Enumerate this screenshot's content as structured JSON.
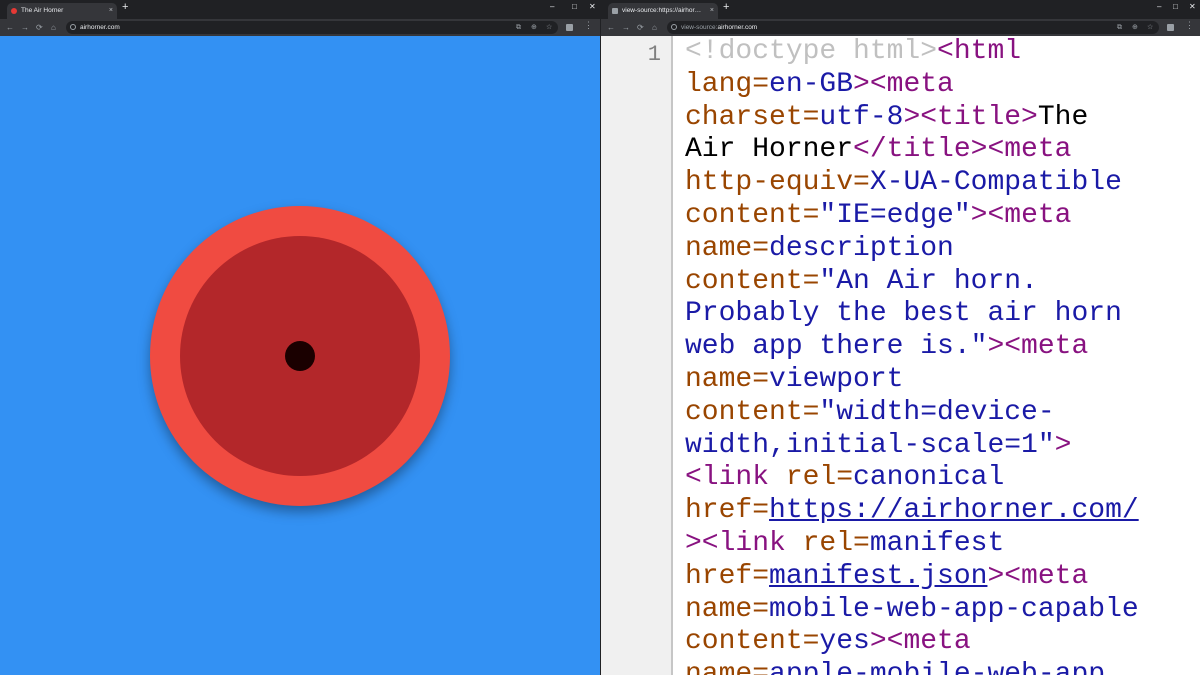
{
  "left_window": {
    "tab": {
      "title": "The Air Horner",
      "favicon_color": "#e53935",
      "close_label": "×"
    },
    "new_tab_label": "+",
    "window_controls": {
      "minimize": "–",
      "maximize": "□",
      "close": "✕"
    },
    "nav": {
      "back": "←",
      "forward": "→",
      "reload": "⟳",
      "home": "⌂"
    },
    "omnibox": {
      "url": "airhorner.com"
    },
    "omnibox_icons": {
      "install": "⧉",
      "zoom": "⊕",
      "bookmark": "☆"
    },
    "menu": "⋮"
  },
  "right_window": {
    "tab": {
      "title": "view-source:https://airhorner.com",
      "favicon_color": "#9aa0a6",
      "close_label": "×"
    },
    "new_tab_label": "+",
    "window_controls": {
      "minimize": "–",
      "maximize": "□",
      "close": "✕"
    },
    "nav": {
      "back": "←",
      "forward": "→",
      "reload": "⟳",
      "home": "⌂"
    },
    "omnibox": {
      "url_prefix": "view-source:",
      "url_main": "airhorner.com"
    },
    "omnibox_icons": {
      "install": "⧉",
      "zoom": "⊕",
      "bookmark": "☆"
    },
    "menu": "⋮"
  },
  "airhorn": {
    "background": "#3391f3",
    "outer_color": "#f04b41",
    "inner_color": "#b3272a",
    "center_color": "#1a0000"
  },
  "source": {
    "line_number": "1",
    "colors": {
      "tag": "#881280",
      "attr": "#994500",
      "value": "#1a1aa6",
      "text": "#000000",
      "doctype": "#c0c0c0"
    },
    "lines": [
      [
        {
          "t": "doc",
          "v": "<!doctype html>"
        },
        {
          "t": "tag",
          "v": "<html"
        }
      ],
      [
        {
          "t": "attr",
          "v": "lang="
        },
        {
          "t": "val",
          "v": "en-GB"
        },
        {
          "t": "tag",
          "v": "><meta"
        }
      ],
      [
        {
          "t": "attr",
          "v": "charset="
        },
        {
          "t": "val",
          "v": "utf-8"
        },
        {
          "t": "tag",
          "v": "><title>"
        },
        {
          "t": "txt",
          "v": "The"
        }
      ],
      [
        {
          "t": "txt",
          "v": "Air Horner"
        },
        {
          "t": "tag",
          "v": "</title><meta"
        }
      ],
      [
        {
          "t": "attr",
          "v": "http-equiv="
        },
        {
          "t": "val",
          "v": "X-UA-Compatible"
        }
      ],
      [
        {
          "t": "attr",
          "v": "content="
        },
        {
          "t": "val",
          "v": "\"IE=edge\""
        },
        {
          "t": "tag",
          "v": "><meta"
        }
      ],
      [
        {
          "t": "attr",
          "v": "name="
        },
        {
          "t": "val",
          "v": "description"
        }
      ],
      [
        {
          "t": "attr",
          "v": "content="
        },
        {
          "t": "val",
          "v": "\"An Air horn."
        }
      ],
      [
        {
          "t": "val",
          "v": "Probably the best air horn"
        }
      ],
      [
        {
          "t": "val",
          "v": "web app there is.\""
        },
        {
          "t": "tag",
          "v": "><meta"
        }
      ],
      [
        {
          "t": "attr",
          "v": "name="
        },
        {
          "t": "val",
          "v": "viewport"
        }
      ],
      [
        {
          "t": "attr",
          "v": "content="
        },
        {
          "t": "val",
          "v": "\"width=device-"
        }
      ],
      [
        {
          "t": "val",
          "v": "width,initial-scale=1\""
        },
        {
          "t": "tag",
          "v": ">"
        }
      ],
      [
        {
          "t": "tag",
          "v": "<link"
        },
        {
          "t": "attr",
          "v": " rel="
        },
        {
          "t": "val",
          "v": "canonical"
        }
      ],
      [
        {
          "t": "attr",
          "v": "href="
        },
        {
          "t": "link",
          "v": "https://airhorner.com/"
        }
      ],
      [
        {
          "t": "tag",
          "v": "><link"
        },
        {
          "t": "attr",
          "v": " rel="
        },
        {
          "t": "val",
          "v": "manifest"
        }
      ],
      [
        {
          "t": "attr",
          "v": "href="
        },
        {
          "t": "link",
          "v": "manifest.json"
        },
        {
          "t": "tag",
          "v": "><meta"
        }
      ],
      [
        {
          "t": "attr",
          "v": "name="
        },
        {
          "t": "val",
          "v": "mobile-web-app-capable"
        }
      ],
      [
        {
          "t": "attr",
          "v": "content="
        },
        {
          "t": "val",
          "v": "yes"
        },
        {
          "t": "tag",
          "v": "><meta"
        }
      ],
      [
        {
          "t": "attr",
          "v": "name="
        },
        {
          "t": "val",
          "v": "apple-mobile-web-app"
        }
      ]
    ]
  }
}
